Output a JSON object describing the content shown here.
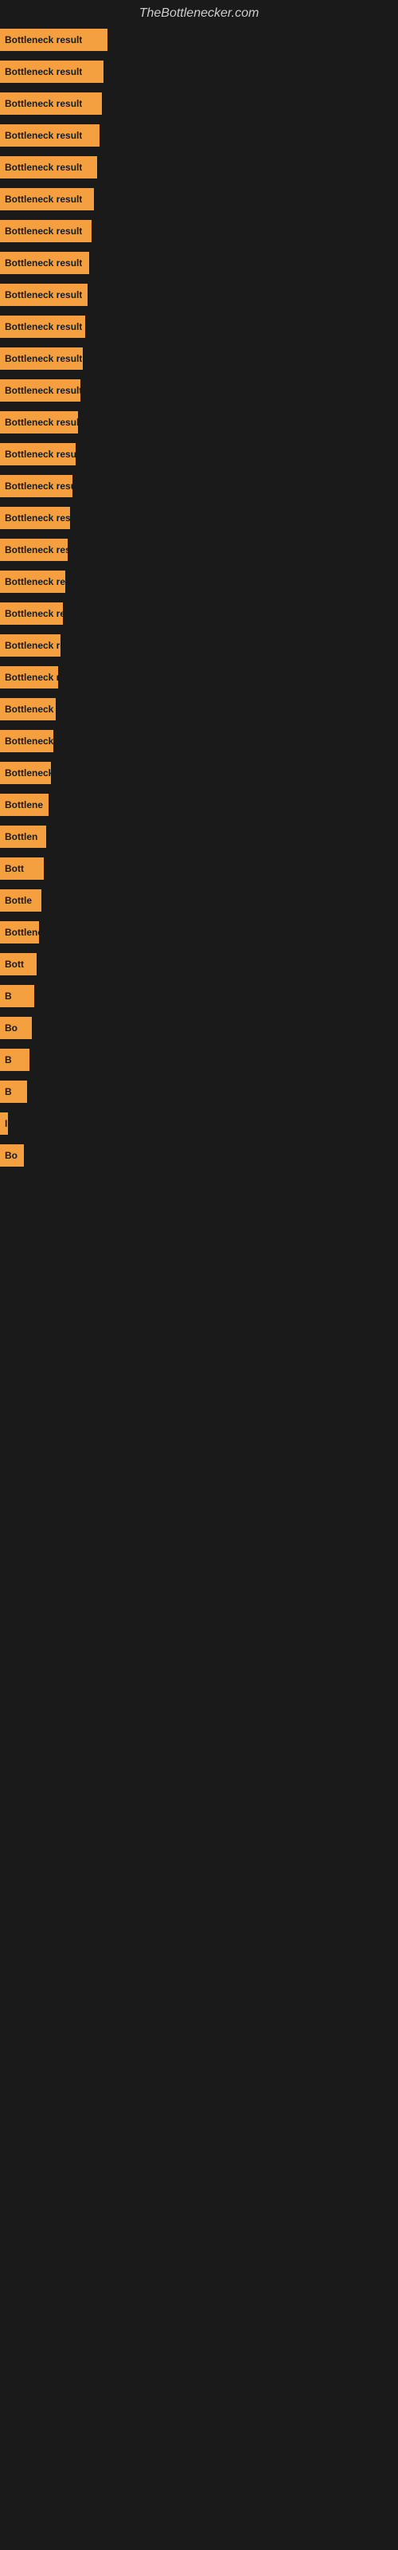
{
  "site": {
    "title": "TheBottlenecker.com"
  },
  "bars": [
    {
      "label": "Bottleneck result",
      "width": 135
    },
    {
      "label": "Bottleneck result",
      "width": 130
    },
    {
      "label": "Bottleneck result",
      "width": 128
    },
    {
      "label": "Bottleneck result",
      "width": 125
    },
    {
      "label": "Bottleneck result",
      "width": 122
    },
    {
      "label": "Bottleneck result",
      "width": 118
    },
    {
      "label": "Bottleneck result",
      "width": 115
    },
    {
      "label": "Bottleneck result",
      "width": 112
    },
    {
      "label": "Bottleneck result",
      "width": 110
    },
    {
      "label": "Bottleneck result",
      "width": 107
    },
    {
      "label": "Bottleneck result",
      "width": 104
    },
    {
      "label": "Bottleneck result",
      "width": 101
    },
    {
      "label": "Bottleneck result",
      "width": 98
    },
    {
      "label": "Bottleneck result",
      "width": 95
    },
    {
      "label": "Bottleneck result",
      "width": 91
    },
    {
      "label": "Bottleneck result",
      "width": 88
    },
    {
      "label": "Bottleneck result",
      "width": 85
    },
    {
      "label": "Bottleneck resu",
      "width": 82
    },
    {
      "label": "Bottleneck re",
      "width": 79
    },
    {
      "label": "Bottleneck resu",
      "width": 76
    },
    {
      "label": "Bottleneck res",
      "width": 73
    },
    {
      "label": "Bottleneck result",
      "width": 70
    },
    {
      "label": "Bottleneck r",
      "width": 67
    },
    {
      "label": "Bottleneck resu",
      "width": 64
    },
    {
      "label": "Bottlene",
      "width": 61
    },
    {
      "label": "Bottlen",
      "width": 58
    },
    {
      "label": "Bott",
      "width": 55
    },
    {
      "label": "Bottle",
      "width": 52
    },
    {
      "label": "Bottlenec",
      "width": 49
    },
    {
      "label": "Bott",
      "width": 46
    },
    {
      "label": "B",
      "width": 43
    },
    {
      "label": "Bo",
      "width": 40
    },
    {
      "label": "B",
      "width": 37
    },
    {
      "label": "B",
      "width": 34
    },
    {
      "label": "I",
      "width": 10
    },
    {
      "label": "Bo",
      "width": 30
    }
  ],
  "colors": {
    "bar_fill": "#f5a040",
    "background": "#1a1a1a",
    "title": "#cccccc"
  }
}
